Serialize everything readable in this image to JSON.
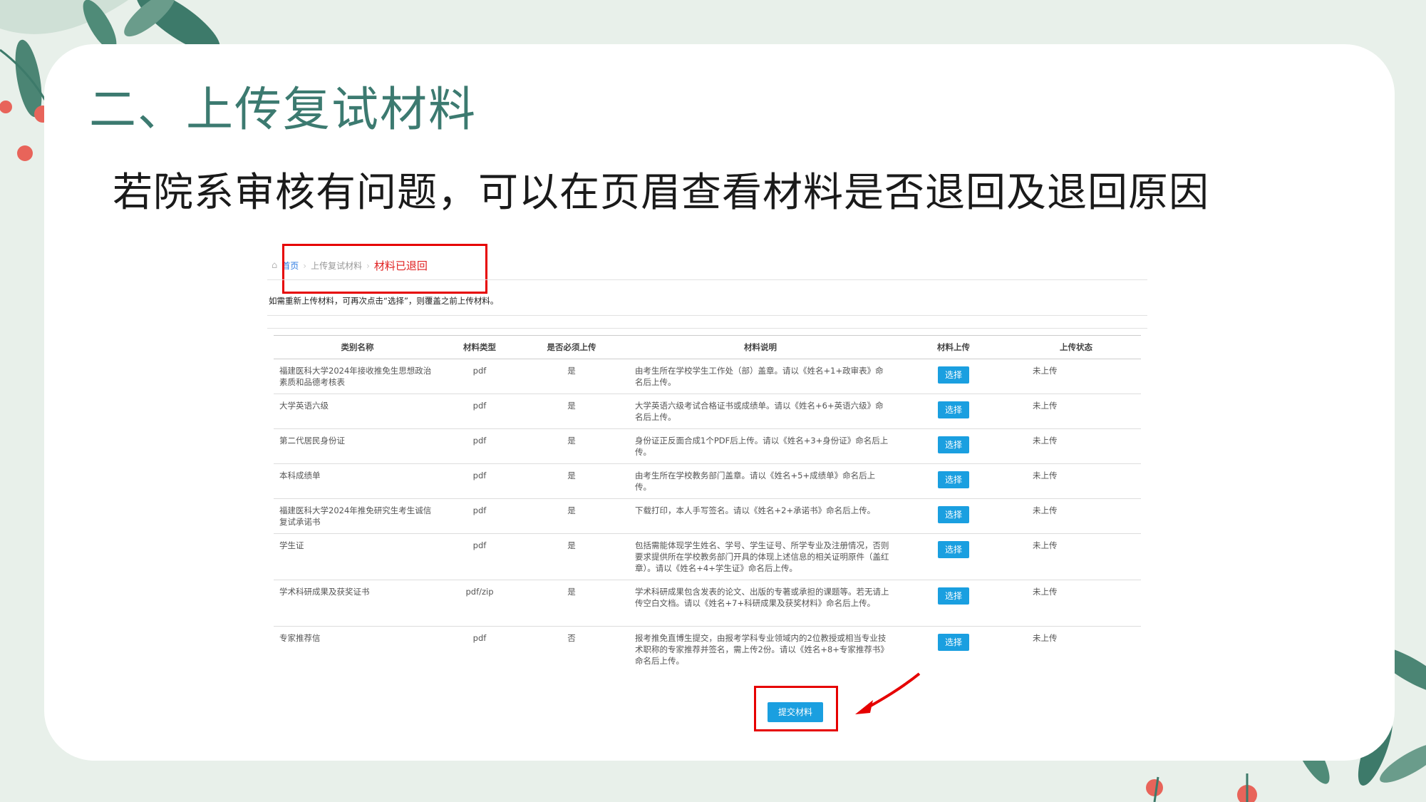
{
  "slide": {
    "title": "二、上传复试材料",
    "subtitle": "若院系审核有问题，可以在页眉查看材料是否退回及退回原因"
  },
  "breadcrumb": {
    "home": "首页",
    "current": "上传复试材料",
    "status": "材料已退回",
    "separator": "›"
  },
  "note": "如需重新上传材料，可再次点击“选择”，则覆盖之前上传材料。",
  "table": {
    "headers": [
      "类别名称",
      "材料类型",
      "是否必须上传",
      "材料说明",
      "材料上传",
      "上传状态"
    ],
    "rows": [
      {
        "name": "福建医科大学2024年接收推免生思想政治素质和品德考核表",
        "type": "pdf",
        "required": "是",
        "desc": "由考生所在学校学生工作处（部）盖章。请以《姓名+1+政审表》命名后上传。",
        "button": "选择",
        "status": "未上传"
      },
      {
        "name": "大学英语六级",
        "type": "pdf",
        "required": "是",
        "desc": "大学英语六级考试合格证书或成绩单。请以《姓名+6+英语六级》命名后上传。",
        "button": "选择",
        "status": "未上传"
      },
      {
        "name": "第二代居民身份证",
        "type": "pdf",
        "required": "是",
        "desc": "身份证正反面合成1个PDF后上传。请以《姓名+3+身份证》命名后上传。",
        "button": "选择",
        "status": "未上传"
      },
      {
        "name": "本科成绩单",
        "type": "pdf",
        "required": "是",
        "desc": "由考生所在学校教务部门盖章。请以《姓名+5+成绩单》命名后上传。",
        "button": "选择",
        "status": "未上传"
      },
      {
        "name": "福建医科大学2024年推免研究生考生诚信复试承诺书",
        "type": "pdf",
        "required": "是",
        "desc": "下载打印，本人手写签名。请以《姓名+2+承诺书》命名后上传。",
        "button": "选择",
        "status": "未上传"
      },
      {
        "name": "学生证",
        "type": "pdf",
        "required": "是",
        "desc": "包括需能体现学生姓名、学号、学生证号、所学专业及注册情况，否则要求提供所在学校教务部门开具的体现上述信息的相关证明原件（盖红章）。请以《姓名+4+学生证》命名后上传。",
        "button": "选择",
        "status": "未上传"
      },
      {
        "name": "学术科研成果及获奖证书",
        "type": "pdf/zip",
        "required": "是",
        "desc": "学术科研成果包含发表的论文、出版的专著或承担的课题等。若无请上传空白文档。请以《姓名+7+科研成果及获奖材料》命名后上传。",
        "button": "选择",
        "status": "未上传"
      },
      {
        "name": "专家推荐信",
        "type": "pdf",
        "required": "否",
        "desc": "报考推免直博生提交，由报考学科专业领域内的2位教授或相当专业技术职称的专家推荐并签名，需上传2份。请以《姓名+8+专家推荐书》命名后上传。",
        "button": "选择",
        "status": "未上传"
      }
    ]
  },
  "submit_label": "提交材料",
  "colors": {
    "title": "#3c7a70",
    "button": "#1a9fe0",
    "highlight": "#e60000",
    "background": "#e8f0ea"
  }
}
